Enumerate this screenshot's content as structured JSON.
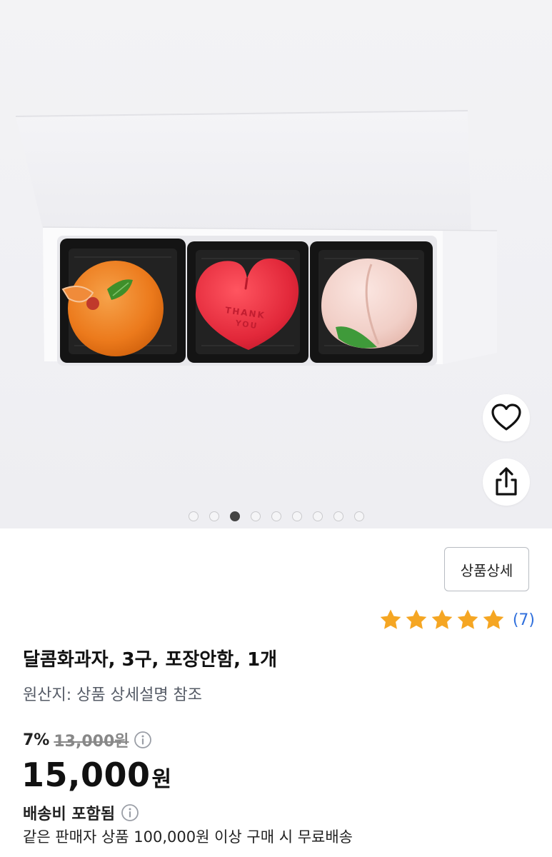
{
  "product_image": {
    "alt": "3 wagashi sweets in a box",
    "heart_button_icon": "heart-outline-icon",
    "share_button_icon": "share-icon",
    "carousel": {
      "total": 9,
      "active_index": 2
    },
    "embossed_text_line1": "THANK",
    "embossed_text_line2": "YOU"
  },
  "detail_button_label": "상품상세",
  "rating": {
    "stars": 5,
    "count_label": "(7)",
    "star_color": "#f5a623"
  },
  "product": {
    "title": "달콤화과자, 3구, 포장안함, 1개",
    "origin": "원산지: 상품 상세설명 참조"
  },
  "pricing": {
    "discount_rate": "7%",
    "original_price": "13,000원",
    "price": "15,000",
    "price_unit": "원"
  },
  "shipping": {
    "label": "배송비 포함됨",
    "note": "같은 판매자 상품 100,000원 이상 구매 시 무료배송"
  },
  "colors": {
    "accent_blue": "#2f6fdc",
    "star": "#f5a623"
  }
}
